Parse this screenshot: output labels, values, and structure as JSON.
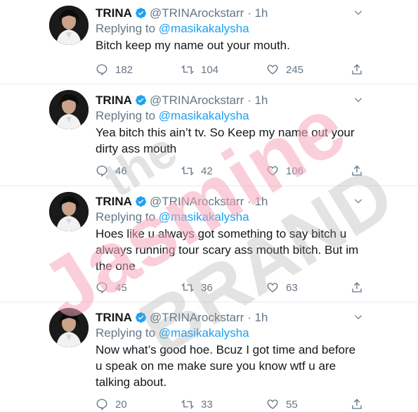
{
  "tweets": [
    {
      "name": "TRINA",
      "handle": "@TRINArockstarr",
      "dot": "·",
      "time": "1h",
      "replying_prefix": "Replying to",
      "replying_to": "@masikakalysha",
      "text": "Bitch keep my name out your mouth.",
      "replies": "182",
      "retweets": "104",
      "likes": "245"
    },
    {
      "name": "TRINA",
      "handle": "@TRINArockstarr",
      "dot": "·",
      "time": "1h",
      "replying_prefix": "Replying to",
      "replying_to": "@masikakalysha",
      "text": "Yea bitch this ain’t tv. So Keep my name out your dirty ass mouth",
      "replies": "46",
      "retweets": "42",
      "likes": "106"
    },
    {
      "name": "TRINA",
      "handle": "@TRINArockstarr",
      "dot": "·",
      "time": "1h",
      "replying_prefix": "Replying to",
      "replying_to": "@masikakalysha",
      "text": "Hoes like u always got something to say bitch u always running tour scary ass mouth bitch. But im the one",
      "replies": "45",
      "retweets": "36",
      "likes": "63"
    },
    {
      "name": "TRINA",
      "handle": "@TRINArockstarr",
      "dot": "·",
      "time": "1h",
      "replying_prefix": "Replying to",
      "replying_to": "@masikakalysha",
      "text": "Now what’s good hoe. Bcuz I got time and before u speak on me make sure you know wtf u are talking about.",
      "replies": "20",
      "retweets": "33",
      "likes": "55"
    }
  ],
  "watermark": {
    "line1": "the",
    "line2": "Jasmine",
    "line3": "BRAND"
  },
  "colors": {
    "text": "#14171a",
    "secondary": "#657786",
    "link": "#1da1f2",
    "verified": "#1da1f2",
    "separator": "#e6ecf0",
    "watermark_pink": "#f6a7b9",
    "watermark_gray": "#9a9a9a"
  },
  "icons": {
    "verified": "verified-badge-icon",
    "chevron": "chevron-down-icon",
    "reply": "reply-icon",
    "retweet": "retweet-icon",
    "like": "heart-icon",
    "share": "share-icon"
  }
}
